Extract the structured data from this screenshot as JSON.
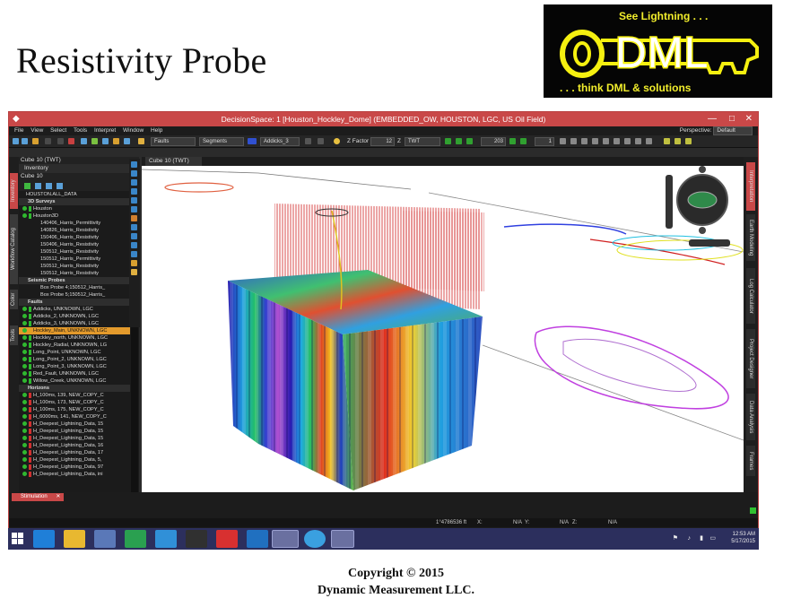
{
  "slide": {
    "title": "Resistivity Probe",
    "logo": {
      "tagline_top": "See Lightning . . .",
      "brand": "DML",
      "tagline_bottom": ". . . think DML & solutions"
    },
    "copyright_line1": "Copyright  © 2015",
    "copyright_line2": "Dynamic  Measurement LLC."
  },
  "app": {
    "window_title": "DecisionSpace: 1 [Houston_Hockley_Dome] (EMBEDDED_OW, HOUSTON, LGC, US Oil Field)",
    "menu": [
      "File",
      "View",
      "Select",
      "Tools",
      "Interpret",
      "Window",
      "Help"
    ],
    "perspective_label": "Perspective:",
    "perspective_value": "Default",
    "toolbar": {
      "faults": "Faults",
      "segments": "Segments",
      "addicks": "Addicks_3",
      "z_factor_label": "Z Factor",
      "z_factor_value": "12",
      "domain": "TWT",
      "slice_value": "203",
      "step_value": "1"
    },
    "panel": {
      "tab_title": "Cube 10 (TWT)",
      "header": "Inventory",
      "subheader": "Cube 10",
      "rows": [
        {
          "text": "HOUSTON.ALL_DATA",
          "type": "root"
        },
        {
          "text": "3D Surveys",
          "type": "section"
        },
        {
          "text": "Houston",
          "type": "item",
          "color": "#2fb82f"
        },
        {
          "text": "Houston3D",
          "type": "item",
          "color": "#2fb82f"
        },
        {
          "text": "140406_Harris_Permittivity",
          "type": "sub"
        },
        {
          "text": "140826_Harris_Resistivity",
          "type": "sub"
        },
        {
          "text": "150406_Harris_Resistivity",
          "type": "sub"
        },
        {
          "text": "150406_Harris_Resistivity",
          "type": "sub"
        },
        {
          "text": "150512_Harris_Resistivity",
          "type": "sub"
        },
        {
          "text": "150512_Harris_Permittivity",
          "type": "sub"
        },
        {
          "text": "150512_Harris_Resistivity",
          "type": "sub"
        },
        {
          "text": "150512_Harris_Resistivity",
          "type": "sub"
        },
        {
          "text": "Seismic Probes",
          "type": "section"
        },
        {
          "text": "Box Probe 4;150512_Harris_",
          "type": "sub"
        },
        {
          "text": "Box Probe 5;150512_Harris_",
          "type": "sub"
        },
        {
          "text": "Faults",
          "type": "section"
        },
        {
          "text": "Addicks, UNKNOWN, LGC",
          "type": "item",
          "color": "#2fb82f"
        },
        {
          "text": "Addicks_2, UNKNOWN, LGC",
          "type": "item",
          "color": "#2fb82f"
        },
        {
          "text": "Addicks_3, UNKNOWN, LGC",
          "type": "item",
          "color": "#2fb82f"
        },
        {
          "text": "Hockley_Main, UNKNOWN, LGC",
          "type": "selected",
          "color": "#e0a020"
        },
        {
          "text": "Hockley_north, UNKNOWN, LGC",
          "type": "item",
          "color": "#2fb82f"
        },
        {
          "text": "Hockley_Radial, UNKNOWN, LG",
          "type": "item",
          "color": "#2fb82f"
        },
        {
          "text": "Long_Point, UNKNOWN, LGC",
          "type": "item",
          "color": "#2fb82f"
        },
        {
          "text": "Long_Point_2, UNKNOWN, LGC",
          "type": "item",
          "color": "#2fb82f"
        },
        {
          "text": "Long_Point_3, UNKNOWN, LGC",
          "type": "item",
          "color": "#2fb82f"
        },
        {
          "text": "Red_Fault, UNKNOWN, LGC",
          "type": "item",
          "color": "#2fb82f"
        },
        {
          "text": "Willow_Creek, UNKNOWN, LGC",
          "type": "item",
          "color": "#2fb82f"
        },
        {
          "text": "Horizons",
          "type": "section"
        },
        {
          "text": "H_100ms, 139, NEW_COPY_C",
          "type": "item",
          "color": "#d03030"
        },
        {
          "text": "H_100ms, 173, NEW_COPY_C",
          "type": "item",
          "color": "#d03030"
        },
        {
          "text": "H_100ms, 175, NEW_COPY_C",
          "type": "item",
          "color": "#d03030"
        },
        {
          "text": "H_6000ms, 141, NEW_COPY_C",
          "type": "item",
          "color": "#d03030"
        },
        {
          "text": "H_Deepest_Lightning_Data, 15",
          "type": "item",
          "color": "#d03030"
        },
        {
          "text": "H_Deepest_Lightning_Data, 15",
          "type": "item",
          "color": "#d03030"
        },
        {
          "text": "H_Deepest_Lightning_Data, 15",
          "type": "item",
          "color": "#d03030"
        },
        {
          "text": "H_Deepest_Lightning_Data, 16",
          "type": "item",
          "color": "#d03030"
        },
        {
          "text": "H_Deepest_Lightning_Data, 17",
          "type": "item",
          "color": "#d03030"
        },
        {
          "text": "H_Deepest_Lightning_Data, 5,",
          "type": "item",
          "color": "#d03030"
        },
        {
          "text": "H_Deepest_Lightning_Data, 97",
          "type": "item",
          "color": "#d03030"
        },
        {
          "text": "H_Deepest_Lightning_Data, ini",
          "type": "item",
          "color": "#d03030"
        }
      ]
    },
    "left_tabs": [
      "Inventory",
      "Workflow Catalog",
      "Color",
      "Tools"
    ],
    "right_tabs": [
      "Interpretation",
      "Earth Modeling",
      "Log Calculator",
      "Project Designer",
      "Data Analysis",
      "Frames"
    ],
    "viewer_tab": "Cube 10 (TWT)",
    "bottom_tab": "Stimulation",
    "status": {
      "coord": "1°4786536 ft",
      "x_label": "X:",
      "x_value": "N/A",
      "y_label": "Y:",
      "y_value": "N/A",
      "z_label": "Z:",
      "z_value": "N/A"
    }
  },
  "taskbar": {
    "time": "12:53 AM",
    "date": "5/17/2015",
    "apps": [
      "ie-icon",
      "file-explorer-icon",
      "home-icon",
      "store-icon",
      "mail-icon",
      "cursor-app-icon",
      "cloud-app-icon",
      "remote-desktop-icon",
      "decisionspace-icon",
      "sync-icon",
      "globe-icon"
    ]
  }
}
